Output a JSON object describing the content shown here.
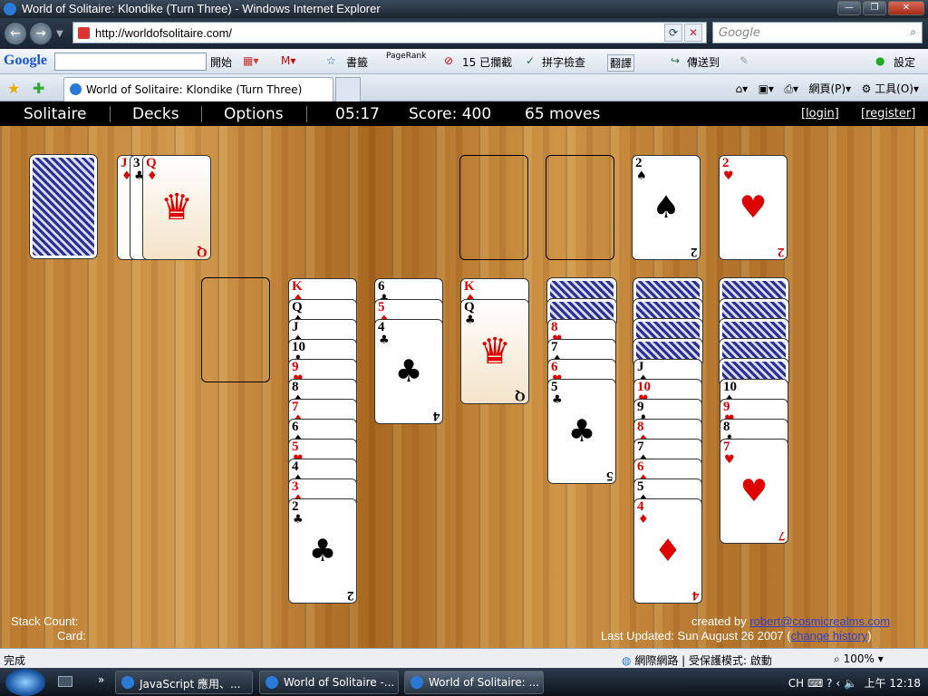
{
  "window": {
    "title": "World of Solitaire: Klondike (Turn Three) - Windows Internet Explorer"
  },
  "address": {
    "url": "http://worldofsolitaire.com/",
    "search_placeholder": "Google"
  },
  "google_toolbar": {
    "logo": "Google",
    "items": [
      "開始",
      "書籤",
      "PageRank",
      "15 已攔截",
      "拼字檢查",
      "翻譯",
      "傳送到",
      "設定"
    ]
  },
  "tabs": [
    {
      "label": "World of Solitaire: Klondike (Turn Three)"
    }
  ],
  "ie_tools": {
    "page": "網頁(P)",
    "tools": "工具(O)"
  },
  "game": {
    "menu": {
      "solitaire": "Solitaire",
      "decks": "Decks",
      "options": "Options",
      "time": "05:17",
      "score": "Score: 400",
      "moves": "65 moves",
      "login": "[login]",
      "register": "[register]"
    },
    "footer": {
      "stack_count": "Stack Count:",
      "card": "Card:",
      "created_by": "created by",
      "email": "robert@cosmicrealms.com",
      "last_updated": "Last Updated: Sun August 26 2007",
      "change_history": "change history"
    }
  },
  "status": {
    "done": "完成",
    "zone": "網際網路 | 受保護模式: 啟動",
    "zoom": "100%"
  },
  "taskbar": {
    "buttons": [
      "JavaScript 應用、...",
      "World of Solitaire -...",
      "World of Solitaire: ..."
    ],
    "lang": "CH",
    "clock": "上午 12:18"
  }
}
